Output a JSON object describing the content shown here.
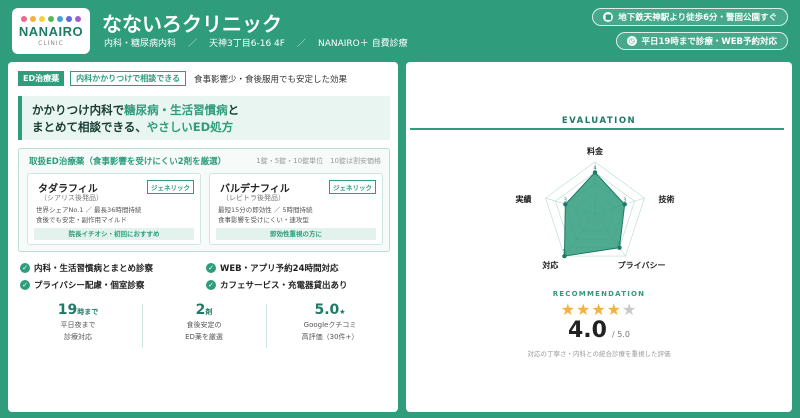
{
  "header": {
    "logo": {
      "name": "NANAIRO",
      "sub": "CLINIC",
      "dots": [
        "#e86a8a",
        "#f1b23c",
        "#f4d23c",
        "#59b55b",
        "#3fa3d6",
        "#5b6bd6",
        "#a35bd6"
      ]
    },
    "title": "なないろクリニック",
    "meta": [
      "内科・糖尿病内科",
      "天神3丁目6-16 4F",
      "NANAIRO＋ 自費診療"
    ],
    "meta_sep": "／",
    "access_pill": "地下鉄天神駅より徒歩6分・警固公園すぐ",
    "hours_pill": "平日19時まで診療・WEB予約対応"
  },
  "left": {
    "badge_ed": "ED治療薬",
    "badge_kakari": "内科かかりつけで相談できる",
    "top_note": "食事影響少・食後服用でも安定した効果",
    "lead": {
      "line1_pre": "かかりつけ内科で",
      "line1_hl": "糖尿病・生活習慣病",
      "line1_post": "と",
      "line2_pre": "まとめて相談できる、",
      "line2_hl": "やさしいED処方"
    },
    "drugbox": {
      "title": "取扱ED治療薬（食事影響を受けにくい2剤を厳選）",
      "sub": "1錠・5錠・10錠単位　10錠は割安価格",
      "drugs": [
        {
          "name": "タダラフィル",
          "generic": "ジェネリック",
          "sub": "（シアリス後発品）",
          "l1": "世界シェアNo.1 ／ 最長36時間持続",
          "l2": "食後でも安定・副作用マイルド",
          "tag": "院長イチオシ・初回におすすめ"
        },
        {
          "name": "バルデナフィル",
          "generic": "ジェネリック",
          "sub": "（レビトラ後発品）",
          "l1": "最短15分の即効性 ／ 5時間持続",
          "l2": "食事影響を受けにくい・速攻型",
          "tag": "即効性重視の方に"
        }
      ]
    },
    "features": [
      "内科・生活習慣病とまとめ診察",
      "WEB・アプリ予約24時間対応",
      "プライバシー配慮・個室診察",
      "カフェサービス・充電器貸出あり"
    ],
    "check_glyph": "✓",
    "stats": [
      {
        "num": "19",
        "unit": "時まで",
        "l1": "平日夜まで",
        "l2": "診療対応"
      },
      {
        "num": "2",
        "unit": "剤",
        "l1": "食後安定の",
        "l2": "ED薬を厳選"
      },
      {
        "num": "5.0",
        "unit": "★",
        "l1": "Googleクチコミ",
        "l2": "高評価（30件+）"
      }
    ]
  },
  "right": {
    "eval_title": "EVALUATION",
    "radar": {
      "axes": [
        "料金",
        "技術",
        "プライバシー",
        "対応",
        "実績"
      ],
      "values": [
        4,
        3,
        4,
        5,
        3
      ],
      "max": 5
    },
    "rec_title": "RECOMMENDATION",
    "stars": {
      "filled": 4,
      "total": 5
    },
    "score": "4.0",
    "score_max": "/ 5.0",
    "note": "対応の丁寧さ・内科との統合診療を重視した評価"
  },
  "colors": {
    "brand": "#2f9c7c",
    "brand_dark": "#1f7a66",
    "star": "#f2b33d"
  }
}
